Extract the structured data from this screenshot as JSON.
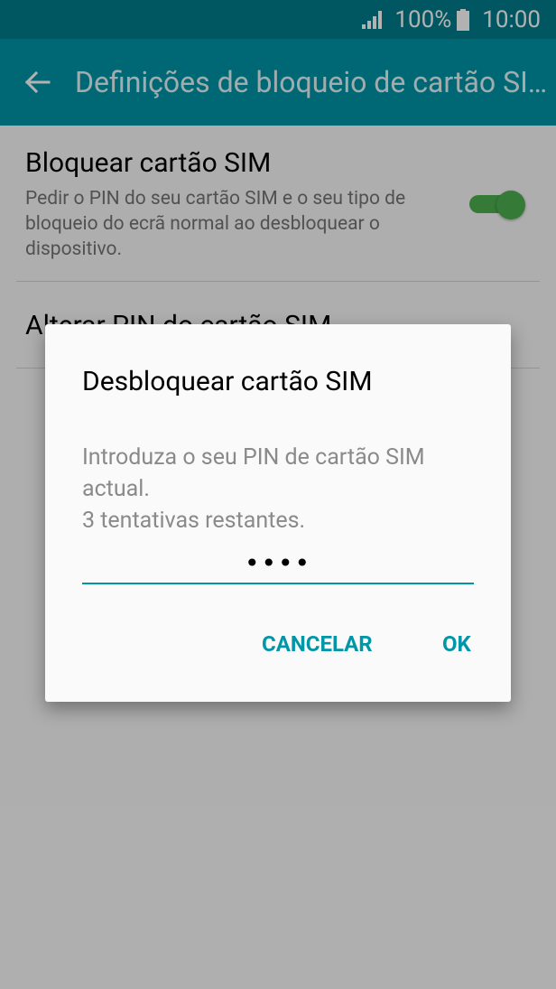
{
  "status_bar": {
    "battery_percent": "100%",
    "time": "10:00",
    "icons": [
      "signal-icon",
      "battery-icon"
    ]
  },
  "app_bar": {
    "title": "Definições de bloqueio de cartão SIM",
    "back_icon": "arrow-left-icon"
  },
  "settings": {
    "lock_sim": {
      "title": "Bloquear cartão SIM",
      "description": "Pedir o PIN do seu cartão SIM e o seu tipo de bloqueio do ecrã normal ao desbloquear o dispositivo.",
      "enabled": true
    },
    "change_pin": {
      "title": "Alterar PIN do cartão SIM"
    }
  },
  "dialog": {
    "title": "Desbloquear cartão SIM",
    "message_line1": "Introduza o seu PIN de cartão SIM actual.",
    "message_line2": "3 tentativas restantes.",
    "pin_value": "••••",
    "cancel_label": "CANCELAR",
    "ok_label": "OK"
  },
  "colors": {
    "status_bar": "#007d8d",
    "app_bar": "#0096a8",
    "accent": "#0096a8",
    "toggle_on": "#4caf50"
  }
}
